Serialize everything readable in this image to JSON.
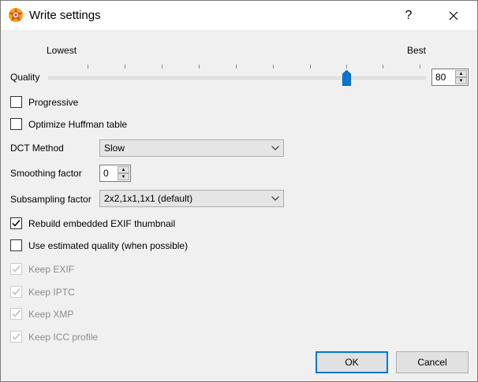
{
  "window": {
    "title": "Write settings",
    "help_label": "?",
    "icon": "app-logo-icon",
    "close_icon": "close-icon"
  },
  "quality": {
    "label": "Quality",
    "min_label": "Lowest",
    "max_label": "Best",
    "value": "80",
    "slider_level_percent": 80
  },
  "options": {
    "progressive": {
      "label": "Progressive",
      "checked": false
    },
    "optimize_huffman": {
      "label": "Optimize Huffman table",
      "checked": false
    },
    "rebuild_exif_thumb": {
      "label": "Rebuild embedded EXIF thumbnail",
      "checked": true
    },
    "estimated_quality": {
      "label": "Use estimated quality (when possible)",
      "checked": false
    },
    "keep_exif": {
      "label": "Keep EXIF",
      "checked": true,
      "disabled": true
    },
    "keep_iptc": {
      "label": "Keep IPTC",
      "checked": true,
      "disabled": true
    },
    "keep_xmp": {
      "label": "Keep XMP",
      "checked": true,
      "disabled": true
    },
    "keep_icc": {
      "label": "Keep ICC profile",
      "checked": true,
      "disabled": true
    }
  },
  "dct": {
    "label": "DCT Method",
    "value": "Slow"
  },
  "smoothing": {
    "label": "Smoothing factor",
    "value": "0"
  },
  "subsampling": {
    "label": "Subsampling factor",
    "value": "2x2,1x1,1x1 (default)"
  },
  "buttons": {
    "ok": "OK",
    "cancel": "Cancel"
  },
  "colors": {
    "accent": "#0078d7",
    "disabled_text": "#8c8c8c"
  }
}
